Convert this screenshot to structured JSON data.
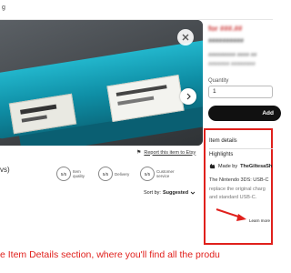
{
  "topbar": {
    "tag": "g"
  },
  "photo": {
    "alt": "product-photo"
  },
  "report_link": "Report this item to Etsy",
  "reviews_count": "vs)",
  "ratings": [
    {
      "score": "5/5",
      "label": "Item quality"
    },
    {
      "score": "5/5",
      "label": "Delivery"
    },
    {
      "score": "5/5",
      "label": "Customer service"
    }
  ],
  "sort": {
    "prefix": "Sort by:",
    "value": "Suggested",
    "chevron": "chevron-down-icon"
  },
  "product": {
    "price": "for ###.##",
    "title_line1": "##########",
    "title_line2": "#########  ####  ##",
    "title_line3": "####### ########"
  },
  "quantity": {
    "label": "Quantity",
    "value": "1"
  },
  "add_button": "Add",
  "item_details": {
    "title": "Item details",
    "highlights": "Highlights",
    "made_by_prefix": "Made by",
    "made_by_shop": "TheGiltesaSh",
    "desc_line1": "The Nintendo 3DS: USB-C",
    "desc_line2": "replace the original charg",
    "desc_line3": "and standard USB-C.",
    "learn_more": "Learn more"
  },
  "caption": "e Item Details section, where you'll find all the produ",
  "colors": {
    "accent_red": "#e0201c",
    "button_black": "#111111"
  }
}
